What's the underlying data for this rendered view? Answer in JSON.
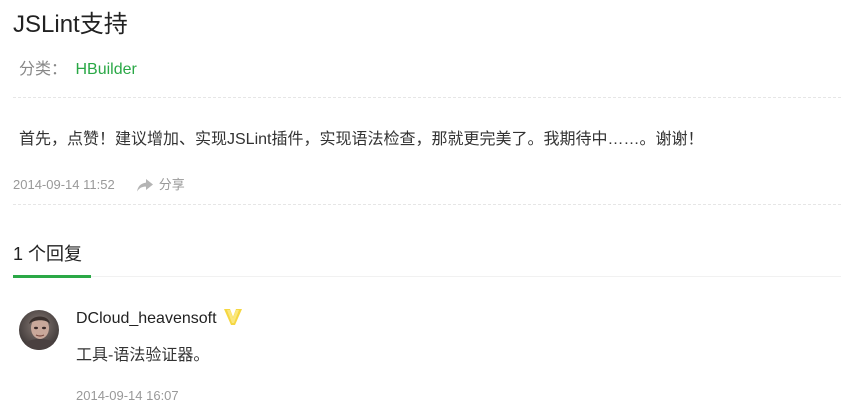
{
  "post": {
    "title": "JSLint支持",
    "category_label": "分类：",
    "category_value": "HBuilder",
    "body": "首先，点赞！建议增加、实现JSLint插件，实现语法检查，那就更完美了。我期待中……。谢谢！",
    "timestamp": "2014-09-14 11:52",
    "share_label": "分享",
    "share_icon": "share-arrow-icon"
  },
  "replies": {
    "count_label": "1 个回复",
    "items": [
      {
        "author": "DCloud_heavensoft",
        "badge_icon": "verified-v-icon",
        "text": "工具-语法验证器。",
        "timestamp": "2014-09-14 16:07"
      }
    ]
  },
  "colors": {
    "accent": "#2aa846",
    "muted": "#999999",
    "badge": "#f5d742"
  }
}
